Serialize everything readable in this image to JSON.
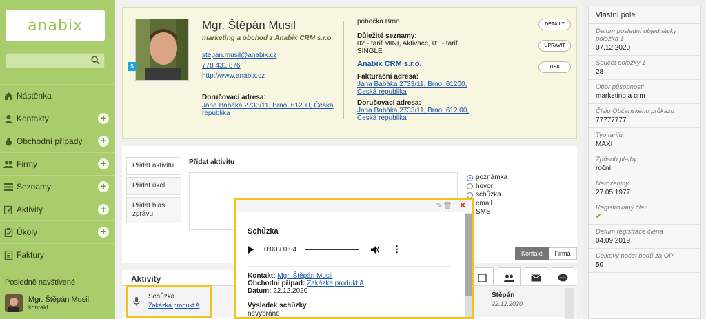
{
  "app": {
    "logo": "anabix"
  },
  "sidebar": {
    "items": [
      {
        "label": "Nástěnka",
        "icon": "home-icon",
        "plus": false
      },
      {
        "label": "Kontakty",
        "icon": "user-icon",
        "plus": true
      },
      {
        "label": "Obchodní případy",
        "icon": "money-bag-icon",
        "plus": true
      },
      {
        "label": "Firmy",
        "icon": "users-icon",
        "plus": true
      },
      {
        "label": "Seznamy",
        "icon": "list-icon",
        "plus": true
      },
      {
        "label": "Aktivity",
        "icon": "edit-icon",
        "plus": true
      },
      {
        "label": "Úkoly",
        "icon": "clipboard-icon",
        "plus": true
      },
      {
        "label": "Faktury",
        "icon": "document-icon",
        "plus": false
      }
    ],
    "recent_header": "Posledně navštívené",
    "recent": {
      "name": "Mgr. Štěpán Musil",
      "type": "kontakt"
    }
  },
  "contact": {
    "badge": "$",
    "name": "Mgr. Štěpán Musil",
    "role_prefix": "marketing a obchod z ",
    "company_link": "Anabix CRM s.r.o.",
    "email": "stepan.musil@anabix.cz",
    "phone": "778 431 876",
    "web": "http://www.anabix.cz",
    "delivery_label": "Doručovací adresa:",
    "delivery_address": "Jana Babáka 2733/11, Brno, 61200, Česká republika",
    "branch": "pobočka Brno",
    "lists_label": "Důležité seznamy:",
    "lists_value": "02 - tarif MINI, Aktivace, 01 - tarif SINGLE",
    "company_name": "Anabix CRM s.r.o.",
    "billing_label": "Fakturační adresa:",
    "billing_address": "Jana Babáka 2733/11, Brno, 61200, Česká republika",
    "company_delivery_label": "Doručovací adresa:",
    "company_delivery_address": "Jana Babáka 2733/11, Brno, 612 00, Česká republika",
    "buttons": {
      "detail": "DETAILY",
      "edit": "UPRAVIT",
      "print": "TISK"
    }
  },
  "add_activity": {
    "tabs": [
      "Přidat aktivitu",
      "Přidat úkol",
      "Přidat hlas. zprávu"
    ],
    "heading": "Přidat aktivitu",
    "types": [
      "poznámka",
      "hovor",
      "schůzka",
      "email",
      "SMS"
    ],
    "selected_type": "poznámka"
  },
  "filter": {
    "contact": "Kontakt",
    "company": "Firma"
  },
  "activities": {
    "heading": "Aktivity",
    "row": {
      "type": "Schůzka",
      "link": "Zakázka produkt A",
      "person": "Štěpán",
      "date": "22.12.2020"
    }
  },
  "popup": {
    "title": "Schůzka",
    "time": "0:00 / 0:04",
    "contact_label": "Kontakt:",
    "contact": "Mgr. Štěpán Musil",
    "deal_label": "Obchodní případ:",
    "deal": "Zakázka produkt A",
    "date_label": "Datum:",
    "date": "22.12.2020",
    "result_label": "Výsledek schůzky",
    "result": "nevybráno"
  },
  "custom_fields": {
    "heading": "Vlastní pole",
    "fields": [
      {
        "label": "Datum poslední objednávky položka 1",
        "value": "07.12.2020"
      },
      {
        "label": "Součet položky 1",
        "value": "28"
      },
      {
        "label": "Obor působnosti",
        "value": "marketing a crm"
      },
      {
        "label": "Číslo Občanského průkazu",
        "value": "77777777"
      },
      {
        "label": "Typ tarifu",
        "value": "MAXI"
      },
      {
        "label": "Způsob platby",
        "value": "roční"
      },
      {
        "label": "Narozeniny",
        "value": "27.05.1977"
      },
      {
        "label": "Registrovaný člen",
        "value": "✔"
      },
      {
        "label": "Datum registrace člena",
        "value": "04.09.2019"
      },
      {
        "label": "Celkový počet bodů za OP",
        "value": "50"
      }
    ]
  },
  "colors": {
    "sidebar": "#a9cc6c",
    "accent": "#f2c31a",
    "link": "#1a56b0"
  }
}
